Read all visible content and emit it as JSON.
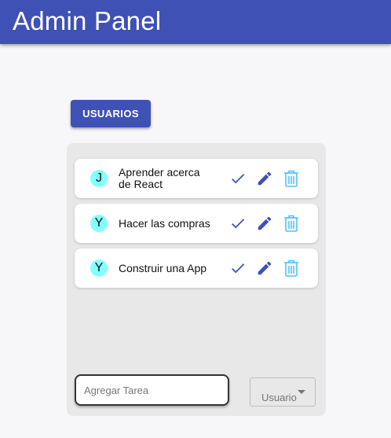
{
  "app": {
    "title": "Admin Panel",
    "accent": "#3f51b5"
  },
  "toolbar": {
    "users_label": "USUARIOS"
  },
  "tasks": [
    {
      "initial": "J",
      "text_line1": "Aprender acerca",
      "text_line2": "de React"
    },
    {
      "initial": "Y",
      "text_line1": "Hacer las compras",
      "text_line2": ""
    },
    {
      "initial": "Y",
      "text_line1": "Construir una App",
      "text_line2": ""
    }
  ],
  "icons": {
    "complete": "check-icon",
    "edit": "pencil-icon",
    "delete": "trash-icon"
  },
  "colors": {
    "avatar_bg": "#84ffff",
    "icon_primary": "#3f51b5",
    "icon_delete": "#4fc3f7"
  },
  "new_task": {
    "placeholder": "Agregar Tarea",
    "value": ""
  },
  "user_select": {
    "label": "Usuario"
  }
}
